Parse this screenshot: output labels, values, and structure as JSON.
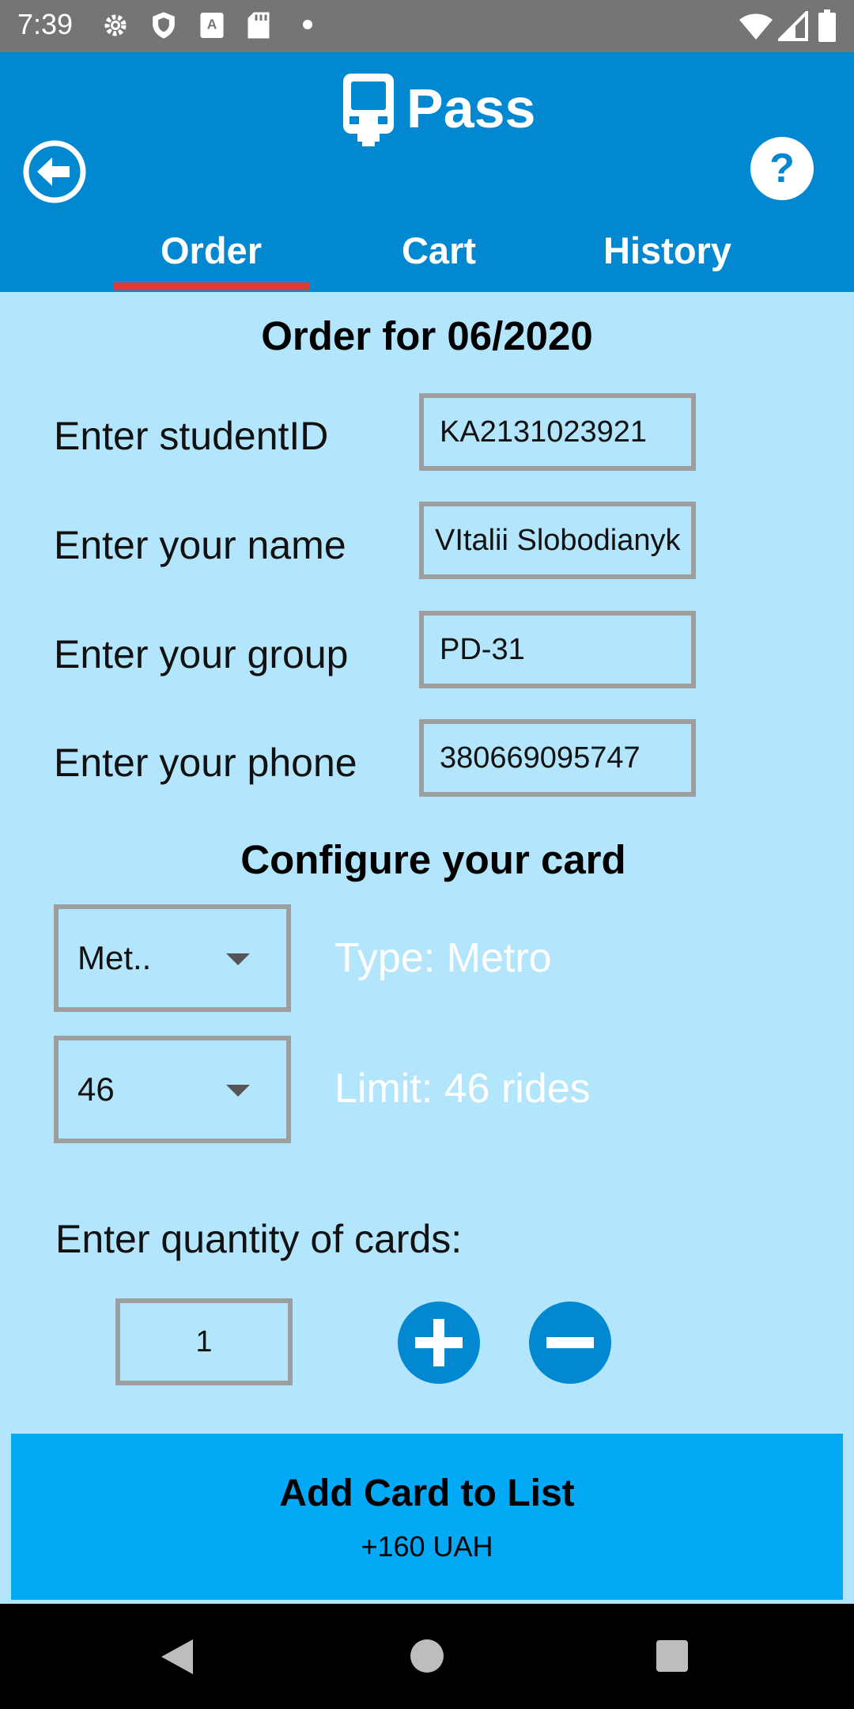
{
  "status_bar": {
    "time": "7:39",
    "icons": [
      "settings-icon",
      "shield-icon",
      "keyboard-a-icon",
      "sd-card-icon",
      "dot-icon",
      "wifi-icon",
      "signal-icon",
      "battery-icon"
    ]
  },
  "app_bar": {
    "title": "Pass",
    "logo_icon": "bus-icon",
    "back_icon": "arrow-left-circle-icon",
    "help_icon": "help-circle-icon",
    "tabs": [
      {
        "label": "Order",
        "active": true
      },
      {
        "label": "Cart",
        "active": false
      },
      {
        "label": "History",
        "active": false
      }
    ]
  },
  "order": {
    "heading": "Order for 06/2020",
    "fields": [
      {
        "label": "Enter studentID",
        "value": "KA2131023921"
      },
      {
        "label": "Enter your name",
        "value": "VItalii Slobodianyk"
      },
      {
        "label": "Enter your group",
        "value": "PD-31"
      },
      {
        "label": "Enter your phone",
        "value": "380669095747"
      }
    ]
  },
  "card_config": {
    "heading": "Configure your card",
    "type_select": {
      "value": "Met..",
      "info": "Type: Metro"
    },
    "limit_select": {
      "value": "46",
      "info": "Limit: 46 rides"
    }
  },
  "quantity": {
    "label": "Enter quantity of cards:",
    "value": "1",
    "plus_icon": "plus-circle-icon",
    "minus_icon": "minus-circle-icon"
  },
  "add_button": {
    "label": "Add Card to List",
    "price": "+160 UAH"
  },
  "colors": {
    "status_bar": "#757575",
    "app_bar": "#0288d1",
    "background": "#b3e5fc",
    "tab_indicator": "#e53935",
    "add_button": "#03a9f4",
    "round_button": "#0288d1"
  }
}
